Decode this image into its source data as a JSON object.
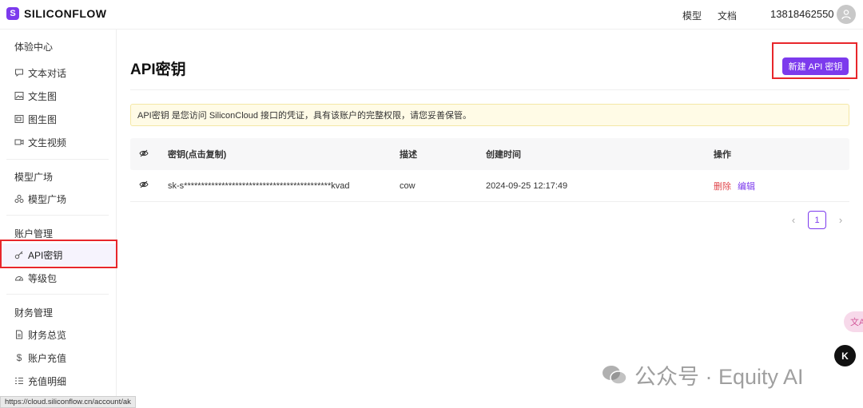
{
  "app": {
    "logo_text": "SILICONFLOW",
    "logo_glyph": "S"
  },
  "topnav": {
    "models": "模型",
    "docs": "文档",
    "phone": "13818462550"
  },
  "sidebar": {
    "sections": [
      {
        "title": "体验中心",
        "items": [
          {
            "label": "文本对话",
            "icon": "chat-icon"
          },
          {
            "label": "文生图",
            "icon": "image-icon"
          },
          {
            "label": "图生图",
            "icon": "images-icon"
          },
          {
            "label": "文生视频",
            "icon": "video-icon"
          }
        ]
      },
      {
        "title": "模型广场",
        "items": [
          {
            "label": "模型广场",
            "icon": "cubes-icon"
          }
        ]
      },
      {
        "title": "账户管理",
        "items": [
          {
            "label": "API密钥",
            "icon": "key-icon",
            "active": true
          },
          {
            "label": "等级包",
            "icon": "gauge-icon"
          }
        ]
      },
      {
        "title": "财务管理",
        "items": [
          {
            "label": "财务总览",
            "icon": "file-icon"
          },
          {
            "label": "账户充值",
            "icon": "dollar-icon"
          },
          {
            "label": "充值明细",
            "icon": "list-icon"
          }
        ]
      }
    ]
  },
  "main": {
    "title": "API密钥",
    "create_button": "新建 API 密钥",
    "notice": "API密钥 是您访问 SiliconCloud 接口的凭证，具有该账户的完整权限，请您妥善保管。",
    "table": {
      "columns": [
        "密钥(点击复制)",
        "描述",
        "创建时间",
        "操作"
      ],
      "rows": [
        {
          "key": "sk-s*******************************************kvad",
          "description": "cow",
          "created": "2024-09-25 12:17:49",
          "delete": "删除",
          "edit": "编辑"
        }
      ]
    },
    "pagination": {
      "current": "1",
      "prev": "‹",
      "next": "›"
    }
  },
  "statusbar": {
    "url": "https://cloud.siliconflow.cn/account/ak"
  },
  "floating": {
    "translate": "文A",
    "helper": "K"
  },
  "watermark": {
    "text": "公众号 · Equity AI"
  },
  "colors": {
    "accent": "#7c3aed",
    "highlight": "#e8262b",
    "danger": "#e0464b",
    "notice_bg": "#fffbe6"
  }
}
